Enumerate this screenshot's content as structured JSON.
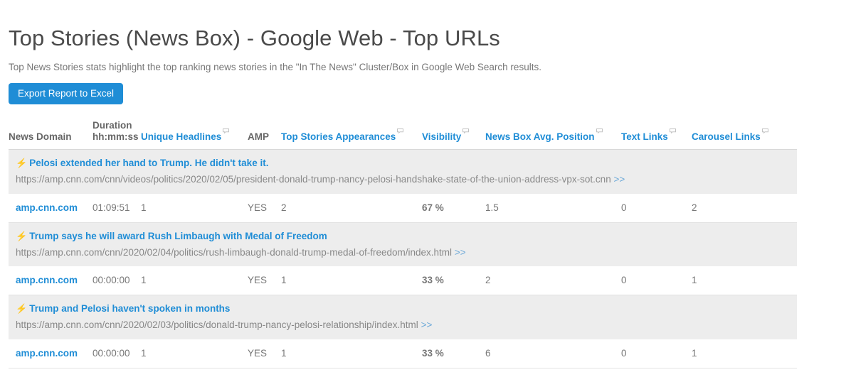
{
  "header": {
    "title": "Top Stories (News Box) - Google Web - Top URLs",
    "subtitle": "Top News Stories stats highlight the top ranking news stories in the \"In The News\" Cluster/Box in Google Web Search results.",
    "export_button": "Export Report to Excel",
    "accent_color": "#1f8dd6"
  },
  "table": {
    "columns": [
      {
        "label": "News Domain",
        "sortable": false,
        "tooltip": false
      },
      {
        "label": "Duration hh:mm:ss",
        "label_line1": "Duration",
        "label_line2": "hh:mm:ss",
        "sortable": false,
        "tooltip": false
      },
      {
        "label": "Unique Headlines",
        "sortable": true,
        "tooltip": true
      },
      {
        "label": "AMP",
        "sortable": false,
        "tooltip": false
      },
      {
        "label": "Top Stories Appearances",
        "sortable": true,
        "tooltip": true
      },
      {
        "label": "Visibility",
        "sortable": true,
        "tooltip": true
      },
      {
        "label": "News Box Avg. Position",
        "sortable": true,
        "tooltip": true
      },
      {
        "label": "Text Links",
        "sortable": true,
        "tooltip": true
      },
      {
        "label": "Carousel Links",
        "sortable": true,
        "tooltip": true
      }
    ],
    "stories": [
      {
        "title": "Pelosi extended her hand to Trump. He didn't take it.",
        "amp_badge": "⚡",
        "url": "https://amp.cnn.com/cnn/videos/politics/2020/02/05/president-donald-trump-nancy-pelosi-handshake-state-of-the-union-address-vpx-sot.cnn",
        "url_more": ">>",
        "row": {
          "news_domain": "amp.cnn.com",
          "duration": "01:09:51",
          "unique_headlines": "1",
          "amp": "YES",
          "top_stories_appearances": "2",
          "visibility": "67 %",
          "news_box_avg_position": "1.5",
          "text_links": "0",
          "carousel_links": "2"
        }
      },
      {
        "title": "Trump says he will award Rush Limbaugh with Medal of Freedom",
        "amp_badge": "⚡",
        "url": "https://amp.cnn.com/cnn/2020/02/04/politics/rush-limbaugh-donald-trump-medal-of-freedom/index.html",
        "url_more": ">>",
        "row": {
          "news_domain": "amp.cnn.com",
          "duration": "00:00:00",
          "unique_headlines": "1",
          "amp": "YES",
          "top_stories_appearances": "1",
          "visibility": "33 %",
          "news_box_avg_position": "2",
          "text_links": "0",
          "carousel_links": "1"
        }
      },
      {
        "title": "Trump and Pelosi haven't spoken in months",
        "amp_badge": "⚡",
        "url": "https://amp.cnn.com/cnn/2020/02/03/politics/donald-trump-nancy-pelosi-relationship/index.html",
        "url_more": ">>",
        "row": {
          "news_domain": "amp.cnn.com",
          "duration": "00:00:00",
          "unique_headlines": "1",
          "amp": "YES",
          "top_stories_appearances": "1",
          "visibility": "33 %",
          "news_box_avg_position": "6",
          "text_links": "0",
          "carousel_links": "1"
        }
      }
    ]
  }
}
